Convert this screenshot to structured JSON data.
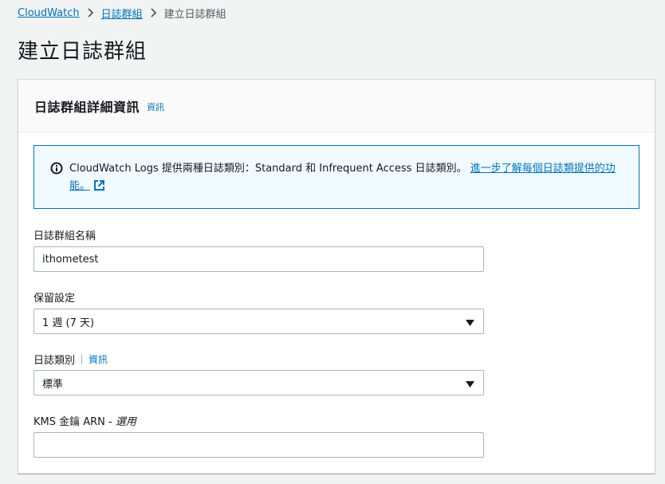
{
  "breadcrumb": {
    "items": [
      "CloudWatch",
      "日誌群組"
    ],
    "current": "建立日誌群組"
  },
  "page_title": "建立日誌群組",
  "panel": {
    "title": "日誌群組詳細資訊",
    "info_label": "資訊",
    "alert": {
      "text": "CloudWatch Logs 提供兩種日誌類別：Standard 和 Infrequent Access 日誌類別。",
      "link_text": "進一步了解每個日誌類提供的功能。"
    },
    "fields": {
      "name": {
        "label": "日誌群組名稱",
        "value": "ithometest"
      },
      "retention": {
        "label": "保留設定",
        "value": "1 週 (7 天)"
      },
      "log_class": {
        "label": "日誌類別",
        "info_label": "資訊",
        "value": "標準"
      },
      "kms": {
        "label": "KMS 金鑰 ARN - ",
        "optional_label": "選用",
        "value": ""
      }
    }
  },
  "colors": {
    "link": "#0073bb",
    "alert_bg": "#f1faff",
    "border": "#aab7b8"
  }
}
